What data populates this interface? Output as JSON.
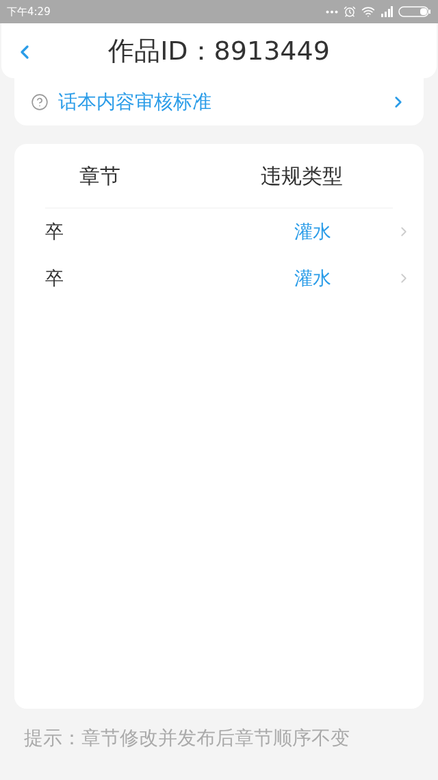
{
  "status_bar": {
    "time": "下午4:29"
  },
  "header": {
    "title": "作品ID：8913449"
  },
  "guide_link": {
    "label": "话本内容审核标准"
  },
  "table": {
    "columns": [
      "章节",
      "违规类型"
    ],
    "rows": [
      {
        "chapter": "卒",
        "violation": "灌水"
      },
      {
        "chapter": "卒",
        "violation": "灌水"
      }
    ]
  },
  "hint": "提示：章节修改并发布后章节顺序不变"
}
